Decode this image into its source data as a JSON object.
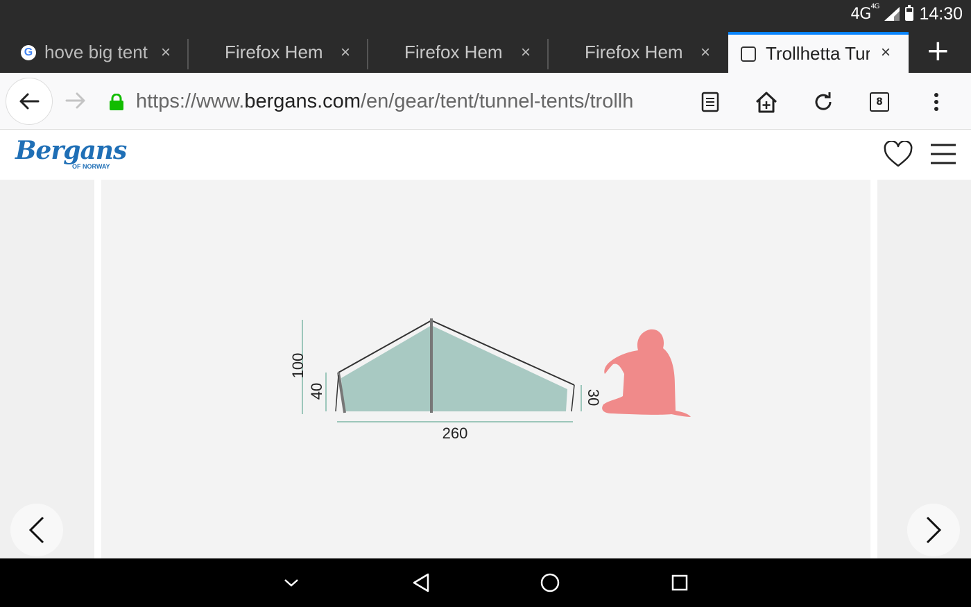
{
  "status_bar": {
    "network": "4G",
    "network_sup": "4G",
    "time": "14:30"
  },
  "tabs": [
    {
      "title": "hove big tent",
      "close": "×",
      "icon": "google-icon",
      "active": false
    },
    {
      "title": "Firefox Hem",
      "close": "×",
      "active": false
    },
    {
      "title": "Firefox Hem",
      "close": "×",
      "active": false
    },
    {
      "title": "Firefox Hem",
      "close": "×",
      "active": false
    },
    {
      "title": "Trollhetta Tur",
      "close": "×",
      "icon": "page-icon",
      "active": true
    }
  ],
  "new_tab_label": "+",
  "url": {
    "scheme": "https://www.",
    "domain": "bergans.com",
    "path": "/en/gear/tent/tunnel-tents/trollh"
  },
  "toolbar": {
    "tabs_count": "8",
    "icons": [
      "back-arrow-icon",
      "forward-arrow-icon",
      "lock-icon",
      "reader-mode-icon",
      "add-to-homescreen-icon",
      "reload-icon",
      "tabs-counter-icon",
      "overflow-menu-icon"
    ]
  },
  "site": {
    "logo_text": "Bergans",
    "logo_sub": "OF NORWAY",
    "accent": "#1f6fb6"
  },
  "diagram": {
    "dim_total_height": "100",
    "dim_front_height": "40",
    "dim_rear_height": "30",
    "dim_length": "260",
    "tent_fill": "#a8c9c2",
    "person_fill": "#f08a8a",
    "dim_line_color": "#7fb8a8"
  },
  "android_nav": {
    "buttons": [
      "hide-keyboard-icon",
      "back-triangle-icon",
      "home-circle-icon",
      "recents-square-icon"
    ]
  }
}
